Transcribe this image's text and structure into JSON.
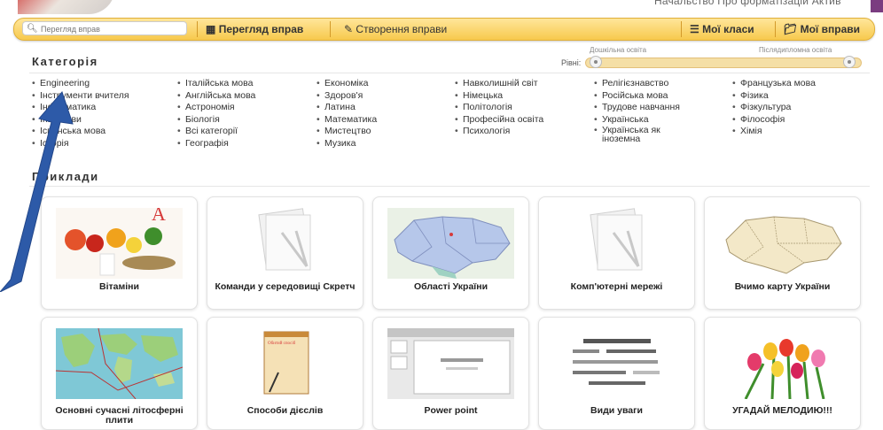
{
  "top": {
    "text": "Начальство Про форматізаціи Актив"
  },
  "nav": {
    "search_placeholder": "Перегляд вправ",
    "browse": "Перегляд вправ",
    "create": "Створення вправи",
    "my_classes": "Мої класи",
    "my_exercises": "Мої вправи"
  },
  "categories": {
    "title": "Категорія",
    "levels_label": "Рівні:",
    "level_min": "Дошкільна освіта",
    "level_max": "Післядипломна освіта",
    "columns": [
      [
        "Engineering",
        "Інструменти вчителя",
        "Інформатика",
        "Інші мови",
        "Іспанська мова",
        "Історія"
      ],
      [
        "Італійська мова",
        "Англійська мова",
        "Астрономія",
        "Біологія",
        "Всі категорії",
        "Географія"
      ],
      [
        "Економіка",
        "Здоров'я",
        "Латина",
        "Математика",
        "Мистецтво",
        "Музика"
      ],
      [
        "Навколишній світ",
        "Німецька",
        "Політологія",
        "Професійна освіта",
        "Психологія"
      ],
      [
        "Релігієзнавство",
        "Російська мова",
        "Трудове навчання",
        "Українська",
        "Українська як іноземна"
      ],
      [
        "Французька мова",
        "Фізика",
        "Фізкультура",
        "Філософія",
        "Хімія"
      ]
    ]
  },
  "examples": {
    "title": "Приклади",
    "cards": [
      "Вітаміни",
      "Команди у середовищі Скретч",
      "Області України",
      "Комп'ютерні мережі",
      "Вчимо карту України",
      "Основні сучасні літосферні плити",
      "Способи дієслів",
      "Power point",
      "Види уваги",
      "УГАДАЙ МЕЛОДИЮ!!!"
    ]
  },
  "icons": {
    "search": "search-icon",
    "browse": "grid-icon",
    "create": "pencil-icon",
    "classes": "list-icon",
    "exercises": "folder-icon"
  },
  "colors": {
    "nav_bg": "#f7c94d",
    "arrow": "#2d5aa8"
  }
}
